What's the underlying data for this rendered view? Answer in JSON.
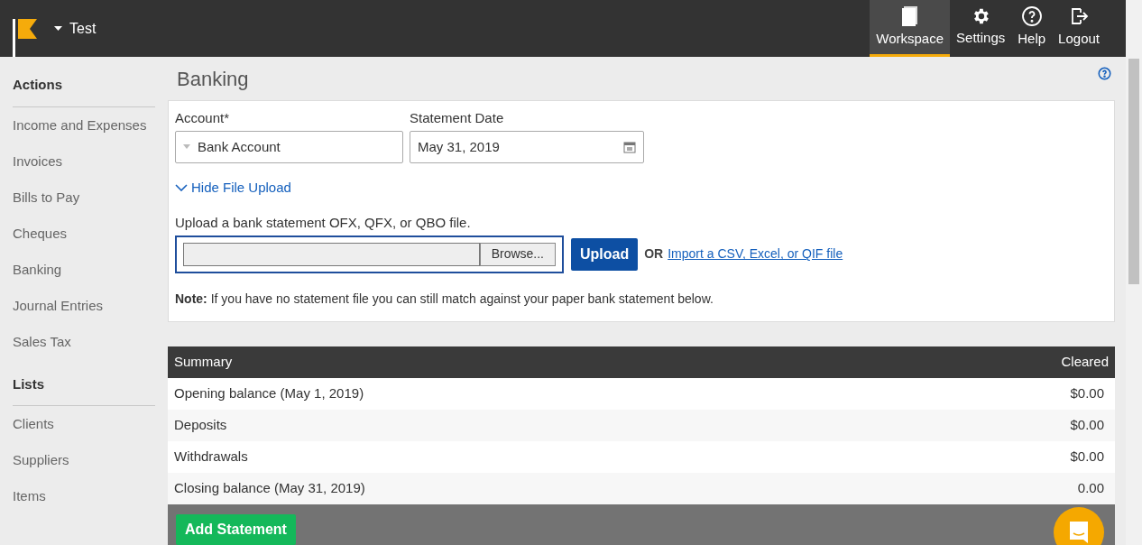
{
  "header": {
    "company": "Test",
    "nav": [
      {
        "kind": "book",
        "label": "Workspace",
        "selected": true
      },
      {
        "kind": "gear",
        "label": "Settings",
        "selected": false
      },
      {
        "kind": "help",
        "label": "Help",
        "selected": false
      },
      {
        "kind": "logout",
        "label": "Logout",
        "selected": false
      }
    ]
  },
  "sidebar": {
    "sections": [
      {
        "title": "Actions",
        "items": [
          "Income and Expenses",
          "Invoices",
          "Bills to Pay",
          "Cheques",
          "Banking",
          "Journal Entries",
          "Sales Tax"
        ]
      },
      {
        "title": "Lists",
        "items": [
          "Clients",
          "Suppliers",
          "Items"
        ]
      }
    ]
  },
  "page_title": "Banking",
  "form": {
    "account_label": "Account*",
    "account_value": "Bank Account",
    "date_label": "Statement Date",
    "date_value": "May 31, 2019",
    "toggle": "Hide File Upload",
    "upload_hint": "Upload a bank statement OFX, QFX, or QBO file.",
    "browse": "Browse...",
    "upload": "Upload",
    "or": "OR",
    "import_link": "Import a CSV, Excel, or QIF file",
    "note": "**Note:** If you have no statement file you can still match against your paper bank statement below."
  },
  "summary": {
    "columns": [
      "Summary",
      "Cleared"
    ],
    "rows": [
      [
        "Opening balance (May 1, 2019)",
        "$0.00"
      ],
      [
        "Deposits",
        "$0.00"
      ],
      [
        "Withdrawals",
        "$0.00"
      ],
      [
        "Closing balance (May 31, 2019)",
        "0.00"
      ]
    ]
  },
  "footer_button": "Add Statement"
}
